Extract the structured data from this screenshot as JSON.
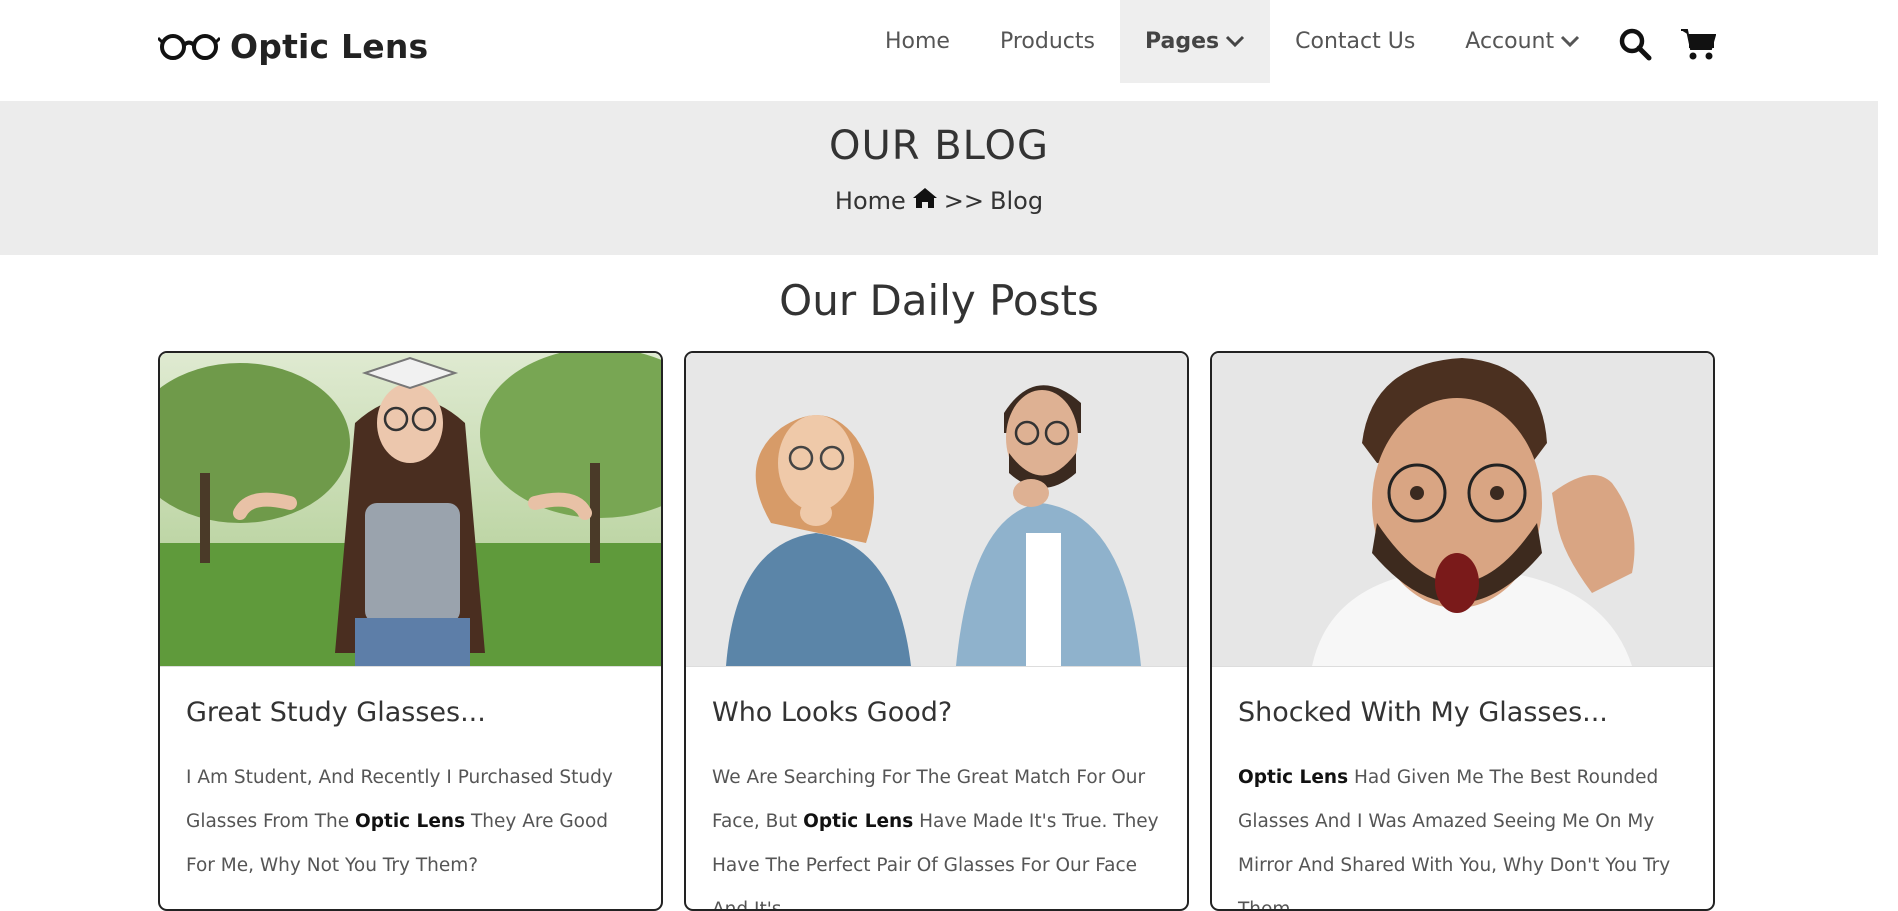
{
  "brand": {
    "name": "Optic Lens"
  },
  "nav": {
    "items": [
      {
        "label": "Home"
      },
      {
        "label": "Products"
      },
      {
        "label": "Pages"
      },
      {
        "label": "Contact Us"
      },
      {
        "label": "Account"
      }
    ]
  },
  "banner": {
    "title": "OUR BLOG",
    "breadcrumb_home": "Home",
    "breadcrumb_sep": ">>",
    "breadcrumb_current": "Blog"
  },
  "section": {
    "title": "Our Daily Posts"
  },
  "posts": [
    {
      "title": "Great Study Glasses...",
      "text_before": "I Am Student, And Recently I Purchased Study Glasses From The ",
      "brand": "Optic Lens",
      "text_after": " They Are Good For Me, Why Not You Try Them?"
    },
    {
      "title": "Who Looks Good?",
      "text_before": "We Are Searching For The Great Match For Our Face, But ",
      "brand": "Optic Lens",
      "text_after": " Have Made It's True. They Have The Perfect Pair Of Glasses For Our Face And It's"
    },
    {
      "title": "Shocked With My Glasses...",
      "text_before": "",
      "brand": "Optic Lens",
      "text_after": " Had Given Me The Best Rounded Glasses And I Was Amazed Seeing Me On My Mirror And Shared With You, Why Don't You Try Them."
    }
  ],
  "icons": {
    "logo": "glasses-icon",
    "search": "search-icon",
    "cart": "cart-icon",
    "home": "home-icon",
    "dropdown": "chevron-down-icon"
  },
  "colors": {
    "banner_bg": "#ececec",
    "nav_active_bg": "#eeeeee",
    "card_border": "#222222"
  }
}
